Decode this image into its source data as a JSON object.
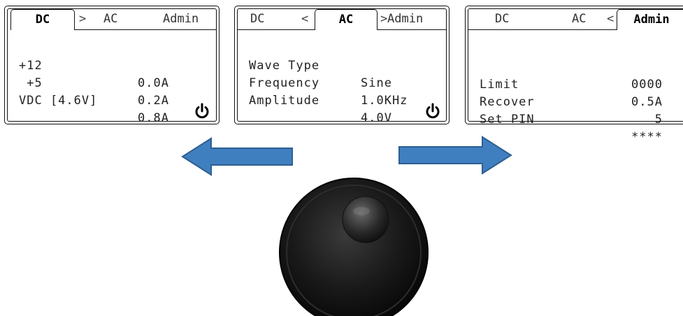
{
  "screens": {
    "dc": {
      "tabs": {
        "dc": "DC",
        "ac": "AC",
        "admin": "Admin",
        "arrow_right": ">"
      },
      "rows": [
        {
          "label": "+12",
          "value": "0.0A"
        },
        {
          "label": " +5",
          "value": "0.2A"
        },
        {
          "label": "VDC [4.6V]",
          "value": "0.8A"
        }
      ]
    },
    "ac": {
      "tabs": {
        "dc": "DC",
        "ac": "AC",
        "admin": "Admin",
        "arrow_left": "<",
        "arrow_right": ">"
      },
      "rows": [
        {
          "label": "Wave Type",
          "value": "Sine"
        },
        {
          "label": "Frequency",
          "value": "1.0KHz"
        },
        {
          "label": "Amplitude",
          "value": "4.0V"
        }
      ]
    },
    "admin": {
      "tabs": {
        "dc": "DC",
        "ac": "AC",
        "admin": "Admin",
        "arrow_left": "<"
      },
      "rows": [
        {
          "label": "",
          "value": "0000"
        },
        {
          "label": "Limit",
          "value": "0.5A"
        },
        {
          "label": "Recover",
          "value": "5"
        },
        {
          "label": "Set PIN",
          "value": "****"
        }
      ]
    }
  },
  "icons": {
    "power": "power-icon",
    "left_arrow": "arrow-left-icon",
    "right_arrow": "arrow-right-icon",
    "knob": "rotary-knob"
  },
  "colors": {
    "arrow_fill": "#3f7fc0",
    "arrow_stroke": "#2e5f93",
    "knob": "#111111"
  }
}
